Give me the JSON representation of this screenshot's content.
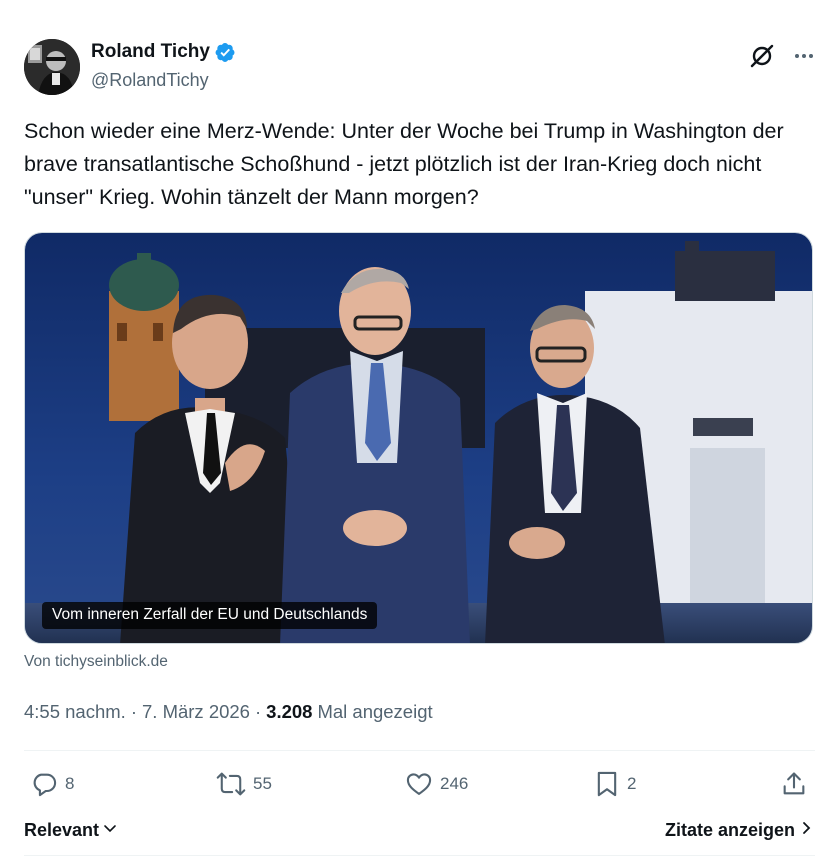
{
  "author": {
    "display_name": "Roland Tichy",
    "handle": "@RolandTichy",
    "verified": true,
    "verified_color": "#1d9bf0"
  },
  "tweet": {
    "text": "Schon wieder eine Merz-Wende: Unter der Woche bei Trump in Washington der brave transatlantische Schoßhund - jetzt plötzlich ist der Iran-Krieg doch nicht \"unser\" Krieg. Wohin tänzelt der Mann morgen?"
  },
  "card": {
    "title": "Vom inneren Zerfall der EU und Deutschlands",
    "source": "Von tichyseinblick.de"
  },
  "meta": {
    "time": "4:55 nachm.",
    "separator": "·",
    "date": "7. März 2026",
    "views": "3.208",
    "views_label": "Mal angezeigt"
  },
  "actions": {
    "replies": "8",
    "reposts": "55",
    "likes": "246",
    "bookmarks": "2"
  },
  "footer": {
    "sort_label": "Relevant",
    "quotes_label": "Zitate anzeigen"
  },
  "icons": {
    "header": [
      "grok-icon",
      "more-icon"
    ],
    "actions": [
      "reply-icon",
      "repost-icon",
      "like-icon",
      "bookmark-icon",
      "share-icon"
    ]
  },
  "colors": {
    "text": "#0f1419",
    "secondary": "#536471",
    "divider": "#eff3f4",
    "sky": "#1b3a7a"
  }
}
